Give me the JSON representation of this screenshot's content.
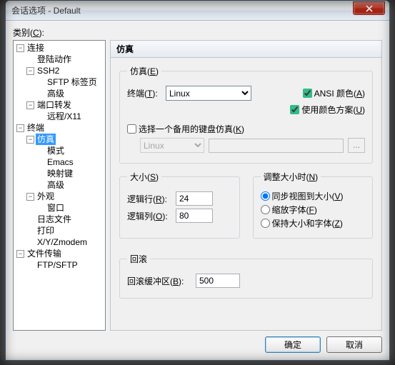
{
  "window": {
    "title": "会话选项 - Default"
  },
  "category_label": "类别(C):",
  "tree": {
    "connection": "连接",
    "login_action": "登陆动作",
    "ssh2": "SSH2",
    "sftp_tab": "SFTP 标签页",
    "advanced1": "高级",
    "port_forward": "端口转发",
    "remote_x11": "远程/X11",
    "terminal": "终端",
    "emulation": "仿真",
    "mode": "模式",
    "emacs": "Emacs",
    "mapped_keys": "映射键",
    "advanced2": "高级",
    "appearance": "外观",
    "window": "窗口",
    "log_file": "日志文件",
    "print": "打印",
    "xyz": "X/Y/Zmodem",
    "file_transfer": "文件传输",
    "ftp_sftp": "FTP/SFTP"
  },
  "panel": {
    "title": "仿真",
    "emu_group": "仿真(E)",
    "terminal_label": "终端(T):",
    "terminal_value": "Linux",
    "ansi_color": "ANSI 颜色(A)",
    "use_color_scheme": "使用颜色方案(U)",
    "alt_kb_label": "选择一个备用的键盘仿真(K)",
    "alt_kb_value": "Linux",
    "ellipsis": "...",
    "size_group": "大小(S)",
    "logical_rows": "逻辑行(R):",
    "logical_rows_val": "24",
    "logical_cols": "逻辑列(O):",
    "logical_cols_val": "80",
    "resize_group": "调整大小时(N)",
    "radio_sync": "同步视图到大小(V)",
    "radio_scale": "缩放字体(F)",
    "radio_keep": "保持大小和字体(Z)",
    "scrollback_group": "回滚",
    "scrollback_buffer": "回滚缓冲区(B):",
    "scrollback_val": "500"
  },
  "buttons": {
    "ok": "确定",
    "cancel": "取消"
  }
}
